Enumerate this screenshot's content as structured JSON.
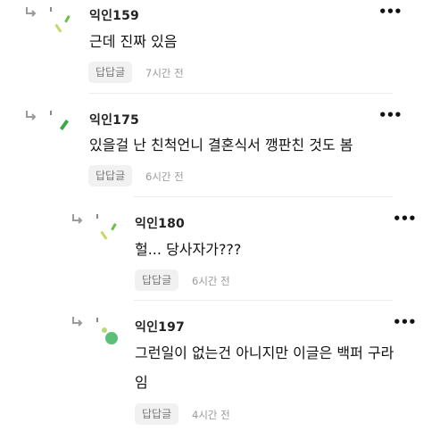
{
  "comments": [
    {
      "author": "익인159",
      "text": "근데 진짜 있음",
      "reply_label": "답답글",
      "time": "7시간 전"
    },
    {
      "author": "익인175",
      "text": "있을걸 난 친척언니 결혼식서 깽판친 것도 봄",
      "reply_label": "답답글",
      "time": "6시간 전"
    },
    {
      "author": "익인180",
      "text": "헐... 당사자가???",
      "reply_label": "답답글",
      "time": "6시간 전"
    },
    {
      "author": "익인197",
      "text_line1": "그런일이 없는건 아니지만 이글은 백퍼 구라",
      "text_line2": "임",
      "reply_label": "답답글",
      "time": "4시간 전"
    }
  ],
  "more_label": "•••",
  "colors": {
    "leaf_light": "#b8d87a",
    "leaf_green": "#5cb85c",
    "dot_green": "#5bbf7a"
  }
}
